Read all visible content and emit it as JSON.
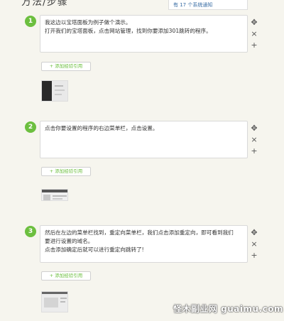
{
  "page": {
    "section_title": "方法/步骤"
  },
  "notification": {
    "text": "有 17 个系统通知"
  },
  "controls": {
    "move": "✥",
    "remove": "×",
    "add": "+"
  },
  "add_reference_label": "+ 添加经验引用",
  "steps": [
    {
      "number": "1",
      "lines": [
        "我这边以宝塔面板为例子做个演示。",
        "打开我们的宝塔面板，点击网站管理，找到你要添加301跳转的程序。"
      ]
    },
    {
      "number": "2",
      "lines": [
        "点击你要设置的程序的右边菜单栏，点击设置。"
      ]
    },
    {
      "number": "3",
      "lines": [
        "然后在左边的菜单栏找到，重定向菜单栏，我们点击添加重定向，即可看到我们",
        "要进行设置的域名。",
        "点击添加确定后就可以进行重定向跳转了!"
      ]
    }
  ],
  "watermark": {
    "text": "怪木副业网 guaimu.com"
  },
  "colors": {
    "accent": "#6cbf3f",
    "background": "#f6f5ee",
    "link": "#3a6ea5"
  }
}
